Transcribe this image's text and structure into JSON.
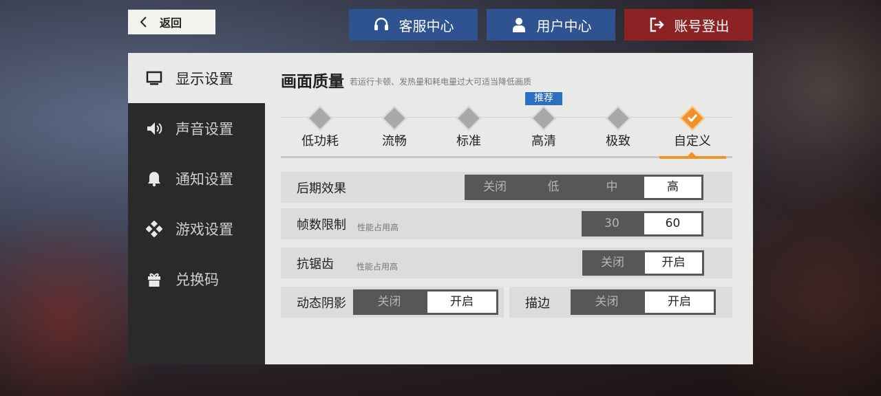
{
  "top": {
    "back_label": "返回",
    "service_label": "客服中心",
    "user_label": "用户中心",
    "logout_label": "账号登出"
  },
  "sidebar": {
    "items": [
      {
        "label": "显示设置",
        "icon": "monitor-icon",
        "active": true
      },
      {
        "label": "声音设置",
        "icon": "speaker-icon",
        "active": false
      },
      {
        "label": "通知设置",
        "icon": "bell-icon",
        "active": false
      },
      {
        "label": "游戏设置",
        "icon": "gamepad-icon",
        "active": false
      },
      {
        "label": "兑换码",
        "icon": "gift-icon",
        "active": false
      }
    ]
  },
  "quality": {
    "title": "画面质量",
    "subtitle": "若运行卡顿、发热量和耗电量过大可适当降低画质",
    "recommend_badge": "推荐",
    "tiers": [
      "低功耗",
      "流畅",
      "标准",
      "高清",
      "极致",
      "自定义"
    ],
    "recommended": "高清",
    "selected": "自定义"
  },
  "settings": {
    "post_effect": {
      "label": "后期效果",
      "options": [
        "关闭",
        "低",
        "中",
        "高"
      ],
      "selected": "高"
    },
    "frame_limit": {
      "label": "帧数限制",
      "hint": "性能占用高",
      "options": [
        "30",
        "60"
      ],
      "selected": "60"
    },
    "antialias": {
      "label": "抗锯齿",
      "hint": "性能占用高",
      "options": [
        "关闭",
        "开启"
      ],
      "selected": "开启"
    },
    "dynamic_shadow": {
      "label": "动态阴影",
      "options": [
        "关闭",
        "开启"
      ],
      "selected": "开启"
    },
    "outline": {
      "label": "描边",
      "options": [
        "关闭",
        "开启"
      ],
      "selected": "开启"
    }
  },
  "colors": {
    "accent": "#f0922a",
    "blue_button": "#2f5390",
    "red_button": "#8c2224",
    "recommend_badge": "#2a6fc0"
  }
}
